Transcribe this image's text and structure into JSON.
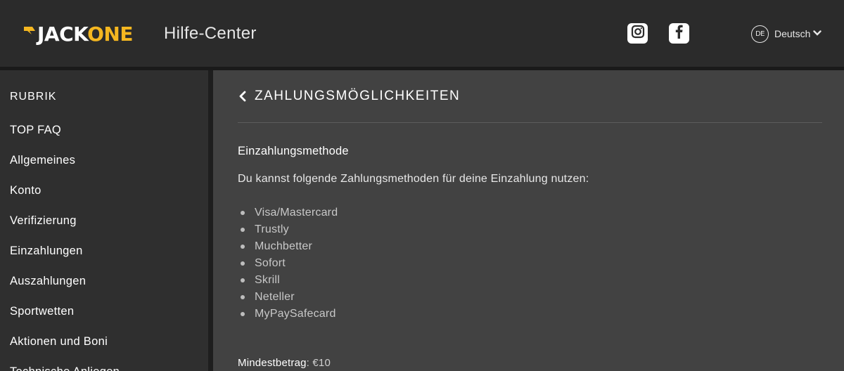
{
  "header": {
    "logo": {
      "part1": "JACK",
      "part2": "ONE",
      "brand_color": "#f5b720"
    },
    "title": "Hilfe-Center",
    "social": [
      {
        "name": "instagram-icon"
      },
      {
        "name": "facebook-icon"
      }
    ],
    "language": {
      "code": "DE",
      "label": "Deutsch",
      "icon": "chevron-down-icon"
    }
  },
  "sidebar": {
    "heading": "RUBRIK",
    "items": [
      {
        "label": "TOP FAQ"
      },
      {
        "label": "Allgemeines"
      },
      {
        "label": "Konto"
      },
      {
        "label": "Verifizierung"
      },
      {
        "label": "Einzahlungen"
      },
      {
        "label": "Auszahlungen"
      },
      {
        "label": "Sportwetten"
      },
      {
        "label": "Aktionen und Boni"
      },
      {
        "label": "Technische Anliegen"
      }
    ]
  },
  "main": {
    "back_icon": "chevron-left-icon",
    "title": "ZAHLUNGSMÖGLICHKEITEN",
    "section_title": "Einzahlungsmethode",
    "intro": "Du kannst folgende Zahlungsmethoden für deine Einzahlung nutzen:",
    "methods": [
      "Visa/Mastercard",
      "Trustly",
      "Muchbetter",
      "Sofort",
      "Skrill",
      "Neteller",
      "MyPaySafecard"
    ],
    "min_label": "Mindestbetrag",
    "min_value": ": €10"
  }
}
